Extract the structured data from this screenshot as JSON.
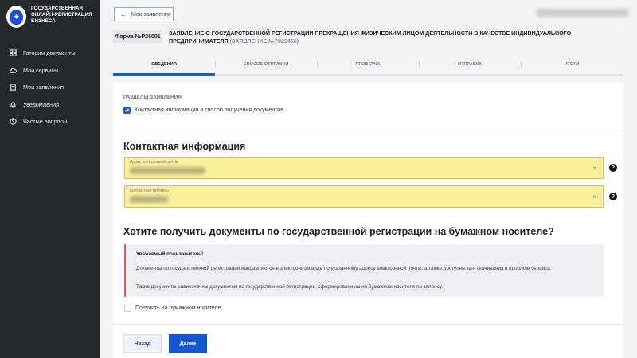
{
  "sidebar": {
    "brand": "Государственная онлайн-регистрация бизнеса",
    "logo_icon": "emblem-icon",
    "items": [
      {
        "label": "Готовим документы",
        "icon": "grid-icon"
      },
      {
        "label": "Мои сервисы",
        "icon": "cloud-icon"
      },
      {
        "label": "Мои заявления",
        "icon": "document-icon"
      },
      {
        "label": "Уведомления",
        "icon": "bell-icon"
      },
      {
        "label": "Частые вопросы",
        "icon": "question-icon"
      }
    ]
  },
  "header": {
    "back_label": "Мои заявления",
    "user_name_redacted": true
  },
  "form": {
    "badge": "Форма №Р26001",
    "title": "Заявление о государственной регистрации прекращения физическим лицом деятельности в качестве индивидуального предпринимателя",
    "subtitle": "(заявление №7821456)"
  },
  "tabs": [
    {
      "label": "Сведения",
      "active": true
    },
    {
      "label": "Способ отправки",
      "active": false
    },
    {
      "label": "Проверка",
      "active": false
    },
    {
      "label": "Отправка",
      "active": false
    },
    {
      "label": "Итоги",
      "active": false
    }
  ],
  "sections": {
    "heading": "Разделы заявления",
    "checkbox_label": "Контактная информация и способ получения документов",
    "checked": true
  },
  "contact": {
    "heading": "Контактная информация",
    "email_label": "Адрес электронной почты",
    "phone_label": "Контактный телефон",
    "clear_symbol": "×",
    "help_symbol": "?"
  },
  "paper": {
    "heading": "Хотите получить документы по государственной регистрации на бумажном носителе?",
    "notice_title": "Уважаемый пользователь!",
    "notice_p1": "Документы по государственной регистрации направляются в электронном виде по указанному адресу электронной почты, а также доступны для скачивания в профиле сервиса.",
    "notice_p2": "Такие документы равнозначны документам по государственной регистрации, сформированным на бумажном носителе по запросу.",
    "checkbox_label": "Получить на бумажном носителе",
    "checked": false
  },
  "actions": {
    "back": "Назад",
    "next": "Далее"
  },
  "colors": {
    "sidebar_bg": "#25282d",
    "accent": "#1457d6",
    "field_highlight": "#fbf19c",
    "notice_border": "#e25a5a"
  }
}
